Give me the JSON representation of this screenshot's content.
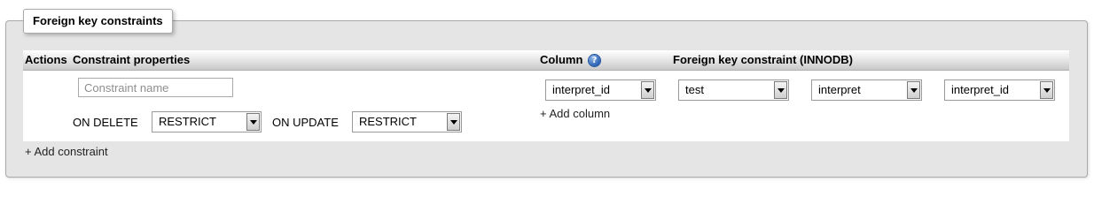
{
  "legend": {
    "title": "Foreign key constraints"
  },
  "table": {
    "headers": {
      "actions": "Actions",
      "constraint_properties": "Constraint properties",
      "column": "Column",
      "fk_constraint": "Foreign key constraint (INNODB)"
    },
    "help_icon": "help-icon"
  },
  "row": {
    "constraint_name_placeholder": "Constraint name",
    "on_delete_label": "ON DELETE",
    "on_delete_value": "RESTRICT",
    "on_update_label": "ON UPDATE",
    "on_update_value": "RESTRICT",
    "column_value": "interpret_id",
    "add_column": "+ Add column",
    "ref_database": "test",
    "ref_table": "interpret",
    "ref_column": "interpret_id"
  },
  "footer": {
    "add_constraint": "+ Add constraint"
  }
}
